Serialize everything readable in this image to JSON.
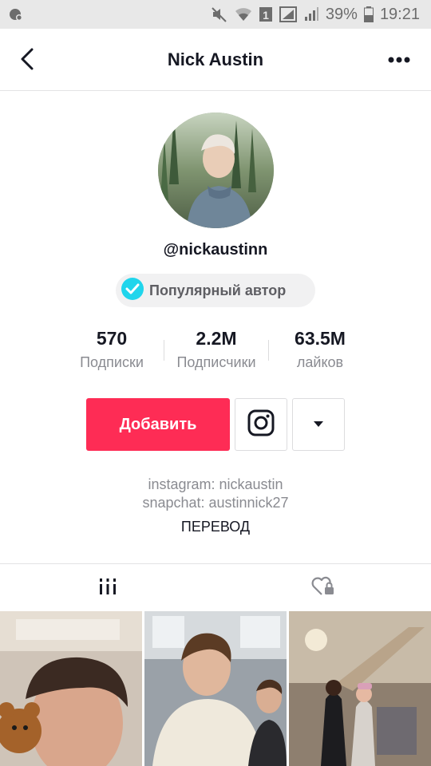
{
  "status_bar": {
    "battery": "39%",
    "time": "19:21",
    "sim": "1"
  },
  "header": {
    "title": "Nick Austin"
  },
  "profile": {
    "username": "@nickaustinn",
    "badge": "Популярный автор",
    "stats": [
      {
        "value": "570",
        "label": "Подписки"
      },
      {
        "value": "2.2M",
        "label": "Подписчики"
      },
      {
        "value": "63.5M",
        "label": "лайков"
      }
    ]
  },
  "actions": {
    "follow_label": "Добавить"
  },
  "bio": {
    "lines": [
      "instagram: nickaustin",
      "snapchat: austinnick27"
    ],
    "translate_label": "ПЕРЕВОД"
  },
  "colors": {
    "accent": "#fe2c55",
    "verified": "#20d5ec",
    "text": "#161823",
    "secondary": "#8a8b91"
  },
  "icons": {
    "back": "chevron-left-icon",
    "more": "more-dots-icon",
    "instagram": "instagram-icon",
    "dropdown": "caret-down-icon",
    "videos_tab": "grid-icon",
    "liked_tab": "locked-heart-icon"
  }
}
